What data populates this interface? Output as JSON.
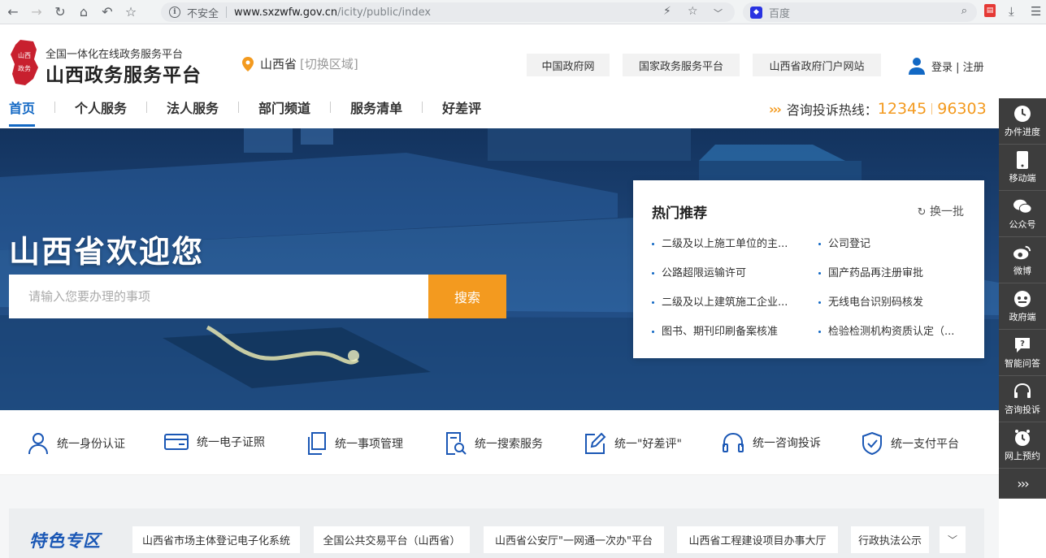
{
  "browser": {
    "security_label": "不安全",
    "url_host": "www.sxzwfw.gov.cn",
    "url_path": "/icity/public/index",
    "search_placeholder": "百度"
  },
  "header": {
    "logo_text": "山西政务",
    "slogan": "全国一体化在线政务服务平台",
    "site_name": "山西政务服务平台",
    "region": "山西省",
    "region_switch": "[切换区域]",
    "top_links": [
      "中国政府网",
      "国家政务服务平台",
      "山西省政府门户网站"
    ],
    "login": "登录 | 注册"
  },
  "nav": {
    "items": [
      "首页",
      "个人服务",
      "法人服务",
      "部门频道",
      "服务清单",
      "好差评"
    ],
    "active_index": 0,
    "hotline_label": "咨询投诉热线：",
    "hotline_numbers": [
      "12345",
      "96303"
    ]
  },
  "banner": {
    "welcome": "山西省欢迎您",
    "search_placeholder": "请输入您要办理的事项",
    "search_button": "搜索"
  },
  "hot": {
    "title": "热门推荐",
    "refresh": "换一批",
    "items": [
      "二级及以上施工单位的主...",
      "公司登记",
      "公路超限运输许可",
      "国产药品再注册审批",
      "二级及以上建筑施工企业...",
      "无线电台识别码核发",
      "图书、期刊印刷备案核准",
      "检验检测机构资质认定（..."
    ]
  },
  "services": [
    {
      "label": "统一身份认证",
      "icon": "user-icon"
    },
    {
      "label": "统一电子证照",
      "icon": "card-icon"
    },
    {
      "label": "统一事项管理",
      "icon": "documents-icon"
    },
    {
      "label": "统一搜索服务",
      "icon": "search-doc-icon"
    },
    {
      "label": "统一\"好差评\"",
      "icon": "edit-icon"
    },
    {
      "label": "统一咨询投诉",
      "icon": "headset-icon"
    },
    {
      "label": "统一支付平台",
      "icon": "shield-check-icon"
    }
  ],
  "feature": {
    "title": "特色专区",
    "chips": [
      "山西省市场主体登记电子化系统",
      "全国公共交易平台（山西省）",
      "山西省公安厅\"一网通一次办\"平台",
      "山西省工程建设项目办事大厅",
      "行政执法公示"
    ]
  },
  "rail": {
    "items": [
      {
        "label": "办件进度",
        "icon": "clock-icon"
      },
      {
        "label": "移动端",
        "icon": "phone-icon"
      },
      {
        "label": "公众号",
        "icon": "wechat-icon"
      },
      {
        "label": "微博",
        "icon": "weibo-icon"
      },
      {
        "label": "政府端",
        "icon": "robot-icon"
      },
      {
        "label": "智能问答",
        "icon": "qa-icon"
      },
      {
        "label": "咨询投诉",
        "icon": "headset-icon"
      },
      {
        "label": "网上预约",
        "icon": "alarm-icon"
      }
    ]
  },
  "colors": {
    "primary": "#1268c4",
    "accent": "#f39a1f",
    "rail": "#3d3d3d",
    "logo": "#c8202f"
  }
}
